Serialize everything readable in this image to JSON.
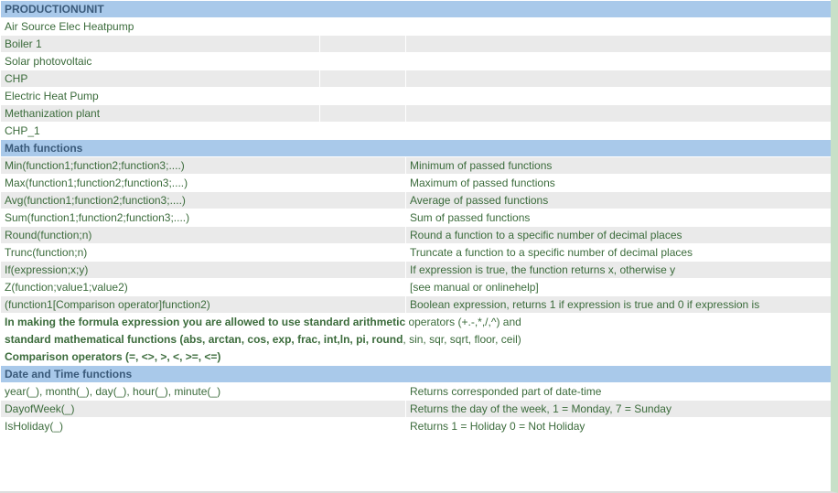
{
  "sections": {
    "productionunit": {
      "title": "PRODUCTIONUNIT",
      "rows": [
        "Air Source Elec Heatpump",
        "Boiler 1",
        "Solar photovoltaic",
        "CHP",
        "Electric Heat Pump",
        "Methanization plant",
        "CHP_1"
      ]
    },
    "math": {
      "title": "Math functions",
      "rows": [
        {
          "fn": "Min(function1;function2;function3;....)",
          "desc": "Minimum of passed functions"
        },
        {
          "fn": "Max(function1;function2;function3;....)",
          "desc": "Maximum of passed functions"
        },
        {
          "fn": "Avg(function1;function2;function3;....)",
          "desc": "Average of passed functions"
        },
        {
          "fn": "Sum(function1;function2;function3;....)",
          "desc": "Sum of passed functions"
        },
        {
          "fn": "Round(function;n)",
          "desc": "Round a function to a specific number of decimal places"
        },
        {
          "fn": "Trunc(function;n)",
          "desc": "Truncate a function to a specific number of decimal places"
        },
        {
          "fn": "If(expression;x;y)",
          "desc": "If expression is true, the function returns x, otherwise y"
        },
        {
          "fn": "Z(function;value1;value2)",
          "desc": "[see manual or onlinehelp]"
        },
        {
          "fn": "(function1[Comparison operator]function2)",
          "desc": "Boolean expression, returns 1 if expression is true and 0 if expression is"
        }
      ]
    },
    "notes": {
      "line1a": "In making the formula expression you are allowed to use standard arithmetic",
      "line1b": " operators (+.-,*,/,^) and",
      "line2a": "standard mathematical functions (abs, arctan, cos, exp, frac, int,ln, pi, round",
      "line2b": ", sin, sqr, sqrt, floor, ceil)",
      "line3": "Comparison operators (=, <>, >, <, >=, <=)"
    },
    "datetime": {
      "title": "Date and Time functions",
      "rows": [
        {
          "fn": "year(_), month(_), day(_), hour(_), minute(_)",
          "desc": "Returns corresponded part of date-time"
        },
        {
          "fn": "DayofWeek(_)",
          "desc": "Returns the day of the week, 1 = Monday, 7 = Sunday"
        },
        {
          "fn": "IsHoliday(_)",
          "desc": "Returns 1 = Holiday 0 = Not Holiday"
        }
      ]
    }
  }
}
